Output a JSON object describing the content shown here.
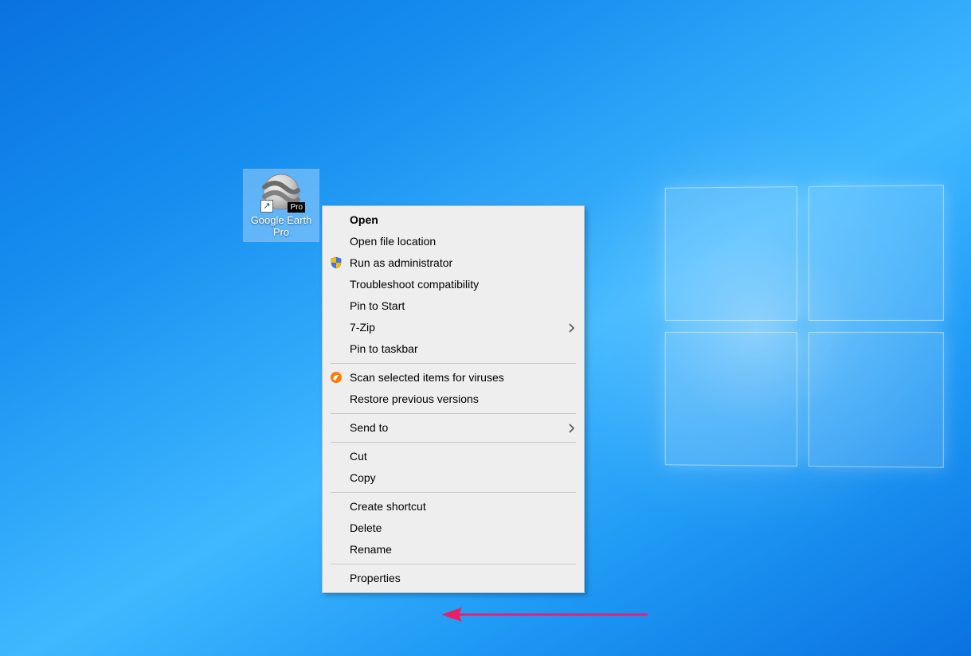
{
  "shortcut": {
    "label": "Google Earth Pro",
    "badge": "Pro",
    "selected": true
  },
  "context_menu": {
    "open": {
      "label": "Open",
      "bold": true
    },
    "open_file_location": {
      "label": "Open file location"
    },
    "run_as_admin": {
      "label": "Run as administrator",
      "icon": "shield-uac"
    },
    "troubleshoot": {
      "label": "Troubleshoot compatibility"
    },
    "pin_to_start": {
      "label": "Pin to Start"
    },
    "seven_zip": {
      "label": "7-Zip",
      "submenu": true
    },
    "pin_to_taskbar": {
      "label": "Pin to taskbar"
    },
    "scan_viruses": {
      "label": "Scan selected items for viruses",
      "icon": "avast"
    },
    "restore_versions": {
      "label": "Restore previous versions"
    },
    "send_to": {
      "label": "Send to",
      "submenu": true
    },
    "cut": {
      "label": "Cut"
    },
    "copy": {
      "label": "Copy"
    },
    "create_shortcut": {
      "label": "Create shortcut"
    },
    "delete": {
      "label": "Delete"
    },
    "rename": {
      "label": "Rename"
    },
    "properties": {
      "label": "Properties"
    }
  },
  "annotation": {
    "target": "properties",
    "color": "#ea1f66"
  }
}
